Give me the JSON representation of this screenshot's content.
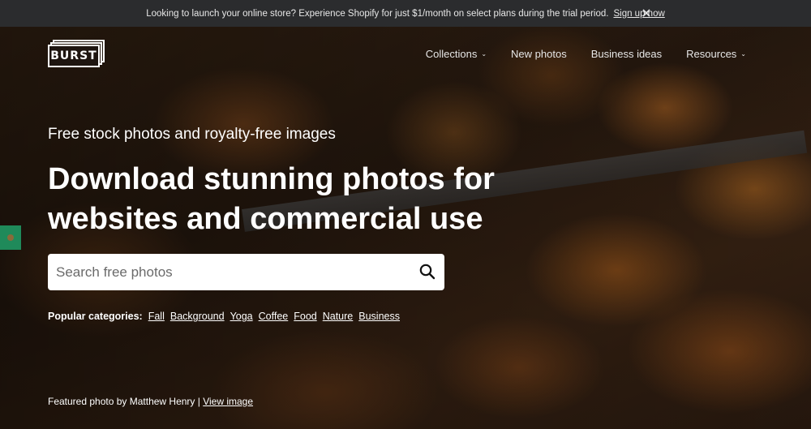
{
  "promo": {
    "text": "Looking to launch your online store? Experience Shopify for just $1/month on select plans during the trial period.",
    "link": "Sign up now",
    "close_icon": "close-icon"
  },
  "header": {
    "logo_text": "BURST",
    "nav": [
      {
        "label": "Collections",
        "has_dropdown": true
      },
      {
        "label": "New photos",
        "has_dropdown": false
      },
      {
        "label": "Business ideas",
        "has_dropdown": false
      },
      {
        "label": "Resources",
        "has_dropdown": true
      }
    ]
  },
  "hero": {
    "subtitle": "Free stock photos and royalty-free images",
    "headline": "Download stunning photos for websites and commercial use",
    "search": {
      "placeholder": "Search free photos",
      "value": "",
      "icon": "search-icon"
    },
    "categories": {
      "label": "Popular categories:",
      "items": [
        "Fall",
        "Background",
        "Yoga",
        "Coffee",
        "Food",
        "Nature",
        "Business"
      ]
    },
    "featured": {
      "text": "Featured photo by Matthew Henry | ",
      "link": "View image"
    }
  },
  "colors": {
    "promo_bg": "#2b2c2e",
    "side_tab": "#1f8a5a",
    "search_bg": "#ffffff"
  }
}
